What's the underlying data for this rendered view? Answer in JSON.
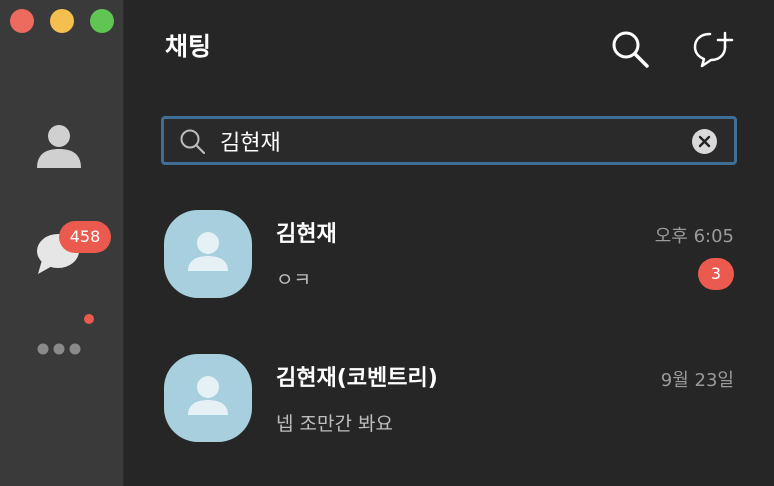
{
  "window": {
    "title": "채팅"
  },
  "sidebar": {
    "nav": [
      {
        "id": "friends",
        "icon": "person-icon"
      },
      {
        "id": "chats",
        "icon": "chat-bubble-icon",
        "badge": "458"
      },
      {
        "id": "more",
        "icon": "more-dots-icon"
      }
    ],
    "colors": {
      "badge": "#ea5a4f",
      "icon": "#d9d9d9"
    }
  },
  "header": {
    "title": "채팅",
    "actions": [
      {
        "icon": "search-icon"
      },
      {
        "icon": "new-chat-icon"
      }
    ]
  },
  "search": {
    "value": "김현재",
    "focus_color": "#3f6f96"
  },
  "chats": [
    {
      "name": "김현재",
      "preview": "ㅇㅋ",
      "time": "오후 6:05",
      "unread": "3"
    },
    {
      "name": "김현재(코벤트리)",
      "preview": "넵 조만간 봐요",
      "time": "9월 23일"
    }
  ],
  "colors": {
    "avatar_bg": "#a7cfde",
    "background": "#262626",
    "sidebar": "#3a3a3a"
  }
}
